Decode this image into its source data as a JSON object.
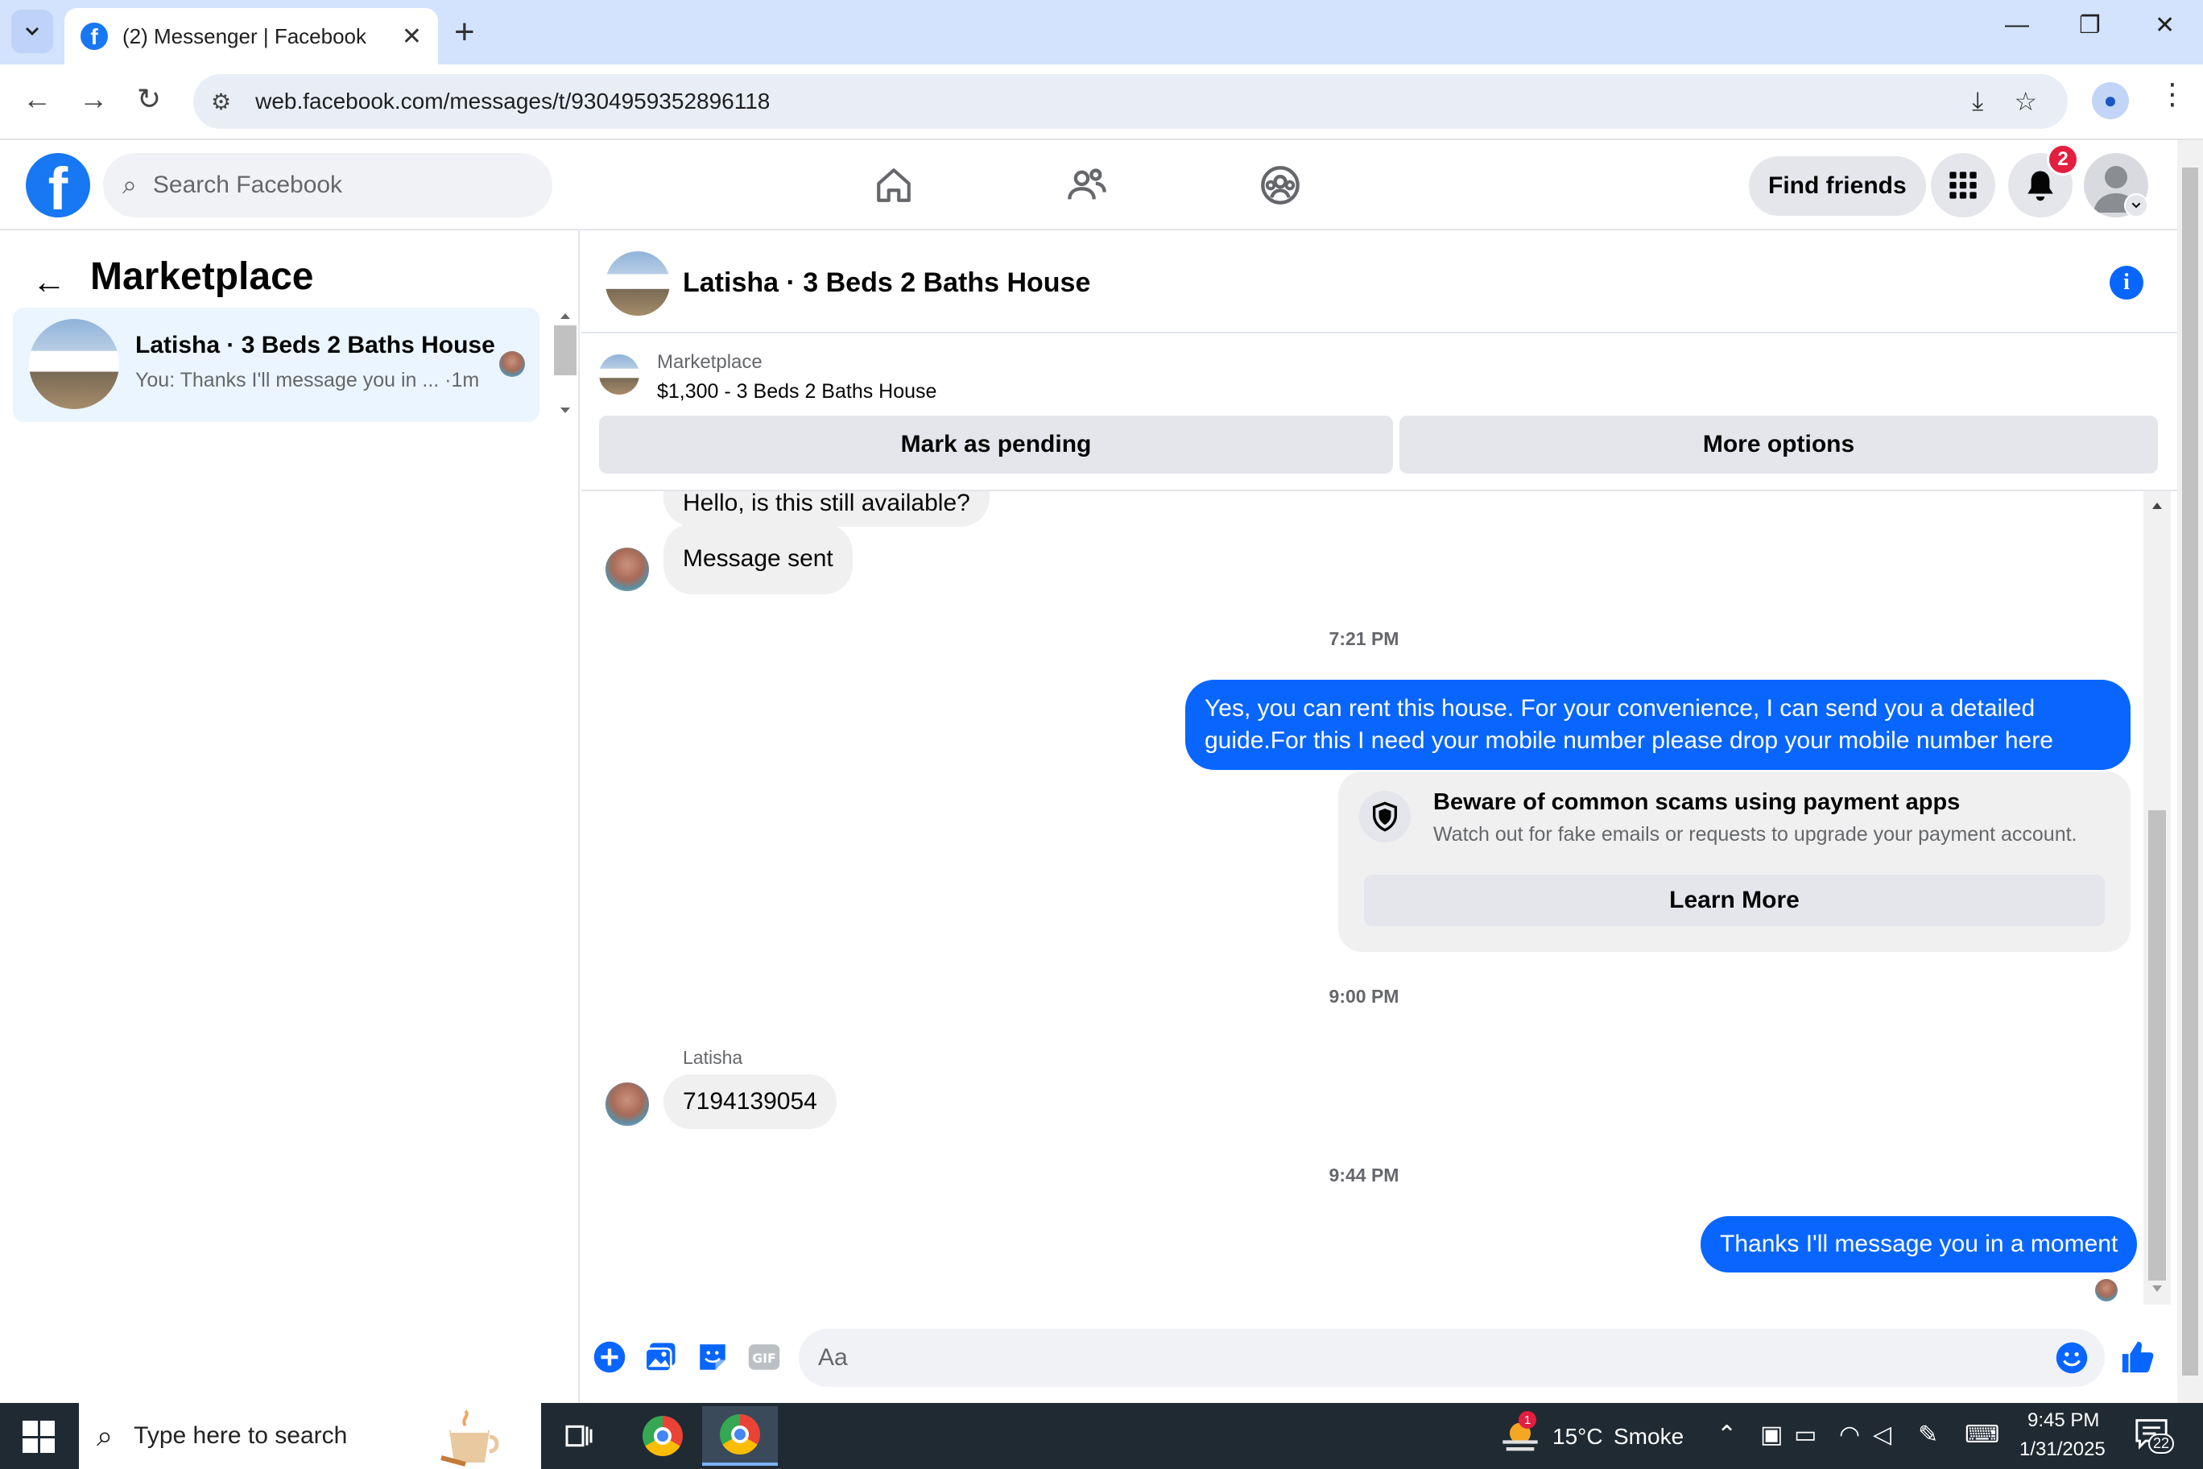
{
  "browser": {
    "tab_title": "(2) Messenger | Facebook",
    "url": "web.facebook.com/messages/t/9304959352896118"
  },
  "fb_header": {
    "search_placeholder": "Search Facebook",
    "find_friends_label": "Find friends",
    "notification_count": "2"
  },
  "sidebar": {
    "title": "Marketplace",
    "conversations": [
      {
        "name": "Latisha · 3 Beds 2 Baths House",
        "preview": "You: Thanks I'll message you in ... ·1m"
      }
    ]
  },
  "chat": {
    "title": "Latisha · 3 Beds 2 Baths House",
    "listing": {
      "label": "Marketplace",
      "price_title": "$1,300 - 3 Beds 2 Baths House",
      "mark_pending_label": "Mark as pending",
      "more_options_label": "More options"
    },
    "messages": {
      "partial_top": "Hello, is this still available?",
      "msg_sent": "Message sent",
      "time_1": "7:21 PM",
      "out_1_line1": "Yes, you can rent this house. For your convenience, I can send you a detailed",
      "out_1_line2": "guide.For this I need your mobile number please drop your mobile number here",
      "scam_title": "Beware of common scams using payment apps",
      "scam_text": "Watch out for fake emails or requests to upgrade your payment account.",
      "learn_more_label": "Learn More",
      "time_2": "9:00 PM",
      "sender_name": "Latisha",
      "in_number": "7194139054",
      "time_3": "9:44 PM",
      "out_2": "Thanks I'll message you in a moment"
    },
    "composer_placeholder": "Aa"
  },
  "taskbar": {
    "search_text": "Type here to search",
    "weather_badge": "1",
    "weather_temp": "15°C",
    "weather_desc": "Smoke",
    "time": "9:45 PM",
    "date": "1/31/2025",
    "notif_count": "22"
  },
  "colors": {
    "fb_blue": "#1877f2",
    "messenger_blue": "#0866ff",
    "badge_red": "#e41e3f"
  }
}
